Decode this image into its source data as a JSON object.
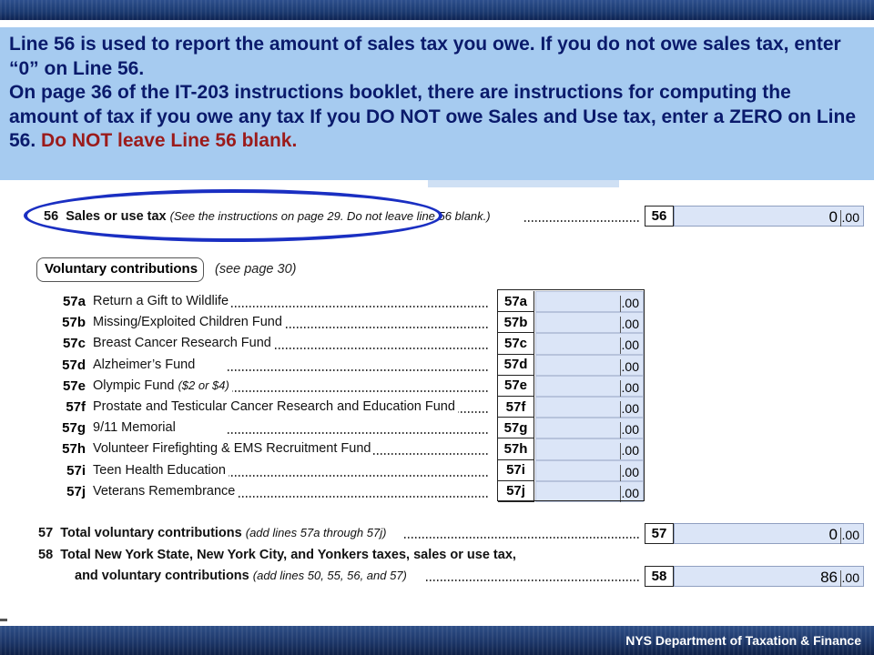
{
  "banner": {
    "line1": " Line 56 is used to report the amount of sales tax you owe.  If you do not owe sales tax, enter “0” on Line 56.",
    "line2_part1": "On page 36 of the IT-203 instructions booklet, there are instructions for computing the amount of tax if you owe any tax  If you DO NOT owe Sales and Use tax, enter a ZERO on Line 56.  ",
    "line2_red": "Do NOT leave Line 56 blank."
  },
  "line56": {
    "number": "56",
    "label": "Sales or use tax",
    "note": "(See the instructions on page 29. Do not leave line 56 blank.)",
    "box": "56",
    "value": "0",
    "cents": ".00"
  },
  "voluntary": {
    "heading": "Voluntary contributions",
    "see": "(see page 30)",
    "items": [
      {
        "code": "57a",
        "label": "Return a Gift to Wildlife",
        "box": "57a",
        "cents": ".00"
      },
      {
        "code": "57b",
        "label": "Missing/Exploited Children Fund",
        "box": "57b",
        "cents": ".00"
      },
      {
        "code": "57c",
        "label": "Breast Cancer Research Fund",
        "box": "57c",
        "cents": ".00"
      },
      {
        "code": "57d",
        "label": "Alzheimer’s Fund",
        "box": "57d",
        "cents": ".00"
      },
      {
        "code": "57e",
        "label": "Olympic Fund",
        "note": "($2 or $4)",
        "box": "57e",
        "cents": ".00"
      },
      {
        "code": "57f",
        "label": "Prostate and Testicular Cancer Research and Education Fund",
        "box": "57f",
        "cents": ".00"
      },
      {
        "code": "57g",
        "label": "9/11 Memorial",
        "box": "57g",
        "cents": ".00"
      },
      {
        "code": "57h",
        "label": "Volunteer Firefighting & EMS Recruitment Fund",
        "box": "57h",
        "cents": ".00"
      },
      {
        "code": "57i",
        "label": "Teen Health Education",
        "box": "57i",
        "cents": ".00"
      },
      {
        "code": "57j",
        "label": "Veterans Remembrance",
        "box": "57j",
        "cents": ".00"
      }
    ]
  },
  "line57": {
    "number": "57",
    "label": "Total voluntary contributions",
    "note": "(add lines 57a through 57j)",
    "box": "57",
    "value": "0",
    "cents": ".00"
  },
  "line58": {
    "number": "58",
    "label_line1": "Total New York State, New York City, and Yonkers taxes, sales or use tax,",
    "label_line2": "and voluntary contributions",
    "note": "(add lines 50, 55, 56, and 57)",
    "box": "58",
    "value": "86",
    "cents": ".00"
  },
  "footer": {
    "org": "NYS Department of Taxation & Finance"
  },
  "colors": {
    "banner_bg": "#a6cbf0",
    "banner_text": "#0a1a6b",
    "banner_red": "#9b1b1b",
    "ellipse": "#1a2fc2",
    "entry_bg": "#dbe5f7",
    "footer_bar": "#1d3769"
  }
}
